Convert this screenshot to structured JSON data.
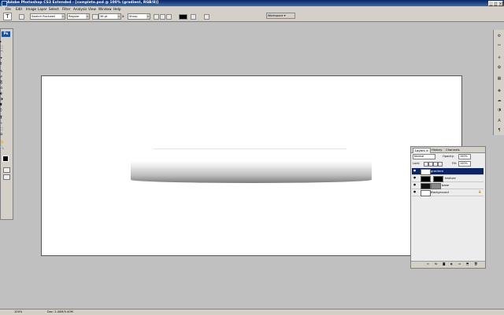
{
  "window": {
    "title": "Adobe Photoshop CS3 Extended - [complete.psd @ 100% (gradient, RGB/8)]"
  },
  "menu": [
    "File",
    "Edit",
    "Image",
    "Layer",
    "Select",
    "Filter",
    "Analysis",
    "View",
    "Window",
    "Help"
  ],
  "options": {
    "tool_glyph": "T",
    "font_family": "Swatch Rockwell",
    "font_style": "Regular",
    "font_size": "36 pt",
    "aa_label": "a",
    "antialias": "Sharp",
    "workspace": "Workspace ▾"
  },
  "toolbox": {
    "logo": "Ps",
    "tools": [
      "▸",
      "⬚",
      "⌒",
      "✦",
      "⌗",
      "✎",
      "✐",
      "⎘",
      "⎌",
      "◐",
      "◑",
      "⬮",
      "⬯",
      "T",
      "✧",
      "⬚",
      "⬭",
      "✋",
      "🔍"
    ]
  },
  "right_dock": {
    "icons": [
      "⚙",
      "✂",
      "⚘",
      "✿",
      "▦",
      "✚",
      "☁",
      "◑",
      "A",
      "¶"
    ]
  },
  "layers_panel": {
    "tabs": [
      "Layers ×",
      "History",
      "Channels"
    ],
    "blend_mode": "Normal",
    "opacity_label": "Opacity:",
    "opacity_value": "100%",
    "lock_label": "Lock:",
    "fill_label": "Fill:",
    "fill_value": "100%",
    "layers": [
      {
        "name": "gradient",
        "selected": true,
        "thumb": "#ffffff"
      },
      {
        "name": "texture",
        "selected": false,
        "thumb": "#000000"
      },
      {
        "name": "base",
        "selected": false,
        "thumb": "#111111"
      },
      {
        "name": "Background",
        "selected": false,
        "thumb": "#ffffff"
      }
    ],
    "footer_icons": [
      "∞",
      "fx",
      "◙",
      "◐",
      "▭",
      "⬒",
      "🗑"
    ]
  },
  "status": {
    "zoom": "100%",
    "doc": "Doc: 2.40M/5.40M"
  }
}
